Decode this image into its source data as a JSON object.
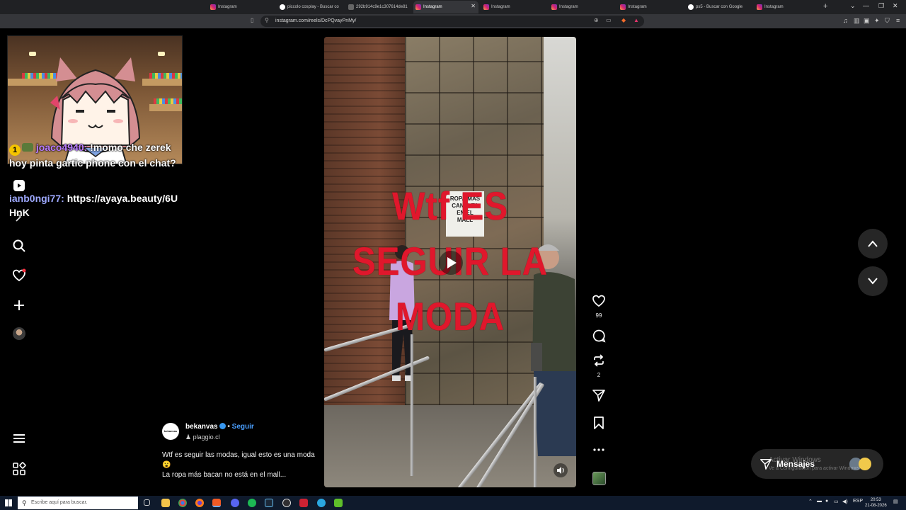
{
  "browser": {
    "tabs": [
      {
        "title": "Instagram",
        "favicon": "instagram",
        "active": false
      },
      {
        "title": "piccolo cosplay - Buscar co",
        "favicon": "google",
        "active": false
      },
      {
        "title": "292b914c9e1c307614de81",
        "favicon": "file",
        "active": false
      },
      {
        "title": "Instagram",
        "favicon": "instagram",
        "active": true
      },
      {
        "title": "Instagram",
        "favicon": "instagram",
        "active": false
      },
      {
        "title": "Instagram",
        "favicon": "instagram",
        "active": false
      },
      {
        "title": "Instagram",
        "favicon": "instagram",
        "active": false
      },
      {
        "title": "ps5 - Buscar con Google",
        "favicon": "google",
        "active": false
      },
      {
        "title": "Instagram",
        "favicon": "instagram",
        "active": false
      }
    ],
    "url": "instagram.com/reels/DcPQvayPnMy/"
  },
  "stream": {
    "chat": [
      {
        "user": "joaco4940:",
        "text": "!momo che zerek hoy pinta gartic phone con el chat?",
        "badge": "1"
      },
      {
        "user": "ianb0ngi77:",
        "text": "https://ayaya.beauty/6UHnK"
      }
    ]
  },
  "reel": {
    "overlay_text": "Wtf ES SEGUIR LA MODA",
    "sign_text": "ROPA MAS CAN N TA EN EL MALL",
    "author": "bekanvas",
    "author_avatar_text": "bekanvas",
    "follow": "Seguir",
    "separator": "•",
    "audio": "plaggio.cl",
    "caption_line1": "Wtf es seguir las modas, igual esto es una moda 😮",
    "caption_line2": "La ropa más bacan no está en el mall...",
    "likes": "99",
    "reposts": "2"
  },
  "messages": {
    "label": "Mensajes",
    "watermark_line1": "Activar Windows",
    "watermark_line2": "Ve a Configuración para activar Windows."
  },
  "taskbar": {
    "search_placeholder": "Escribe aquí para buscar.",
    "lang": "ESP",
    "time": "20:53",
    "date": "21-08-2026"
  },
  "colors": {
    "overlay_red": "#e0172c",
    "follow_blue": "#4a9fff",
    "chat_user1": "#b87cff",
    "chat_user2": "#9ea9ff"
  }
}
